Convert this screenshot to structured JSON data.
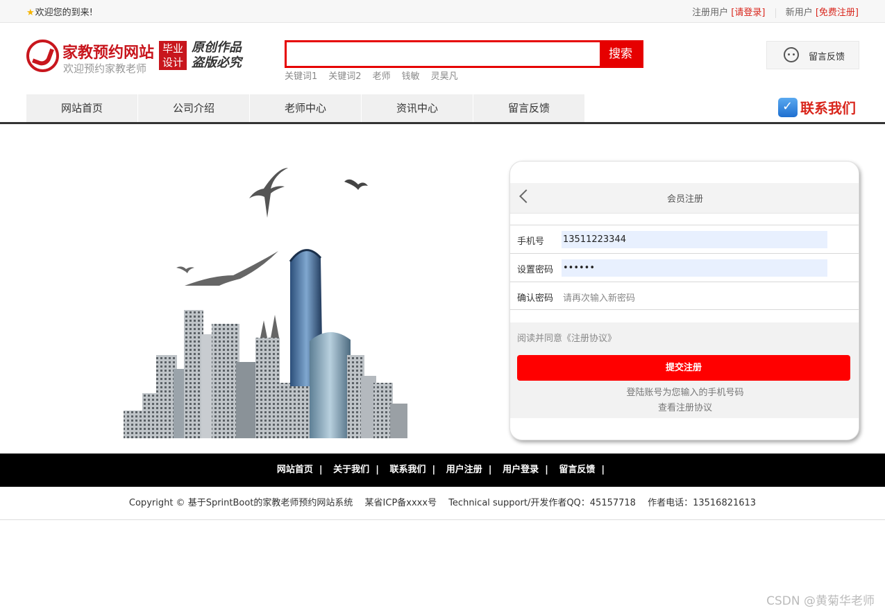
{
  "topbar": {
    "welcome": "欢迎您的到来!",
    "register_prefix": "注册用户",
    "login_link": "[请登录]",
    "new_user_prefix": "新用户",
    "free_register_link": "[免费注册]"
  },
  "header": {
    "site_name": "家教预约网站",
    "site_sub": "欢迎预约家教老师",
    "badge": [
      "毕业",
      "设计"
    ],
    "slogan": [
      "原创作品",
      "盗版必究"
    ],
    "search": {
      "placeholder": "",
      "button": "搜索"
    },
    "keywords": [
      "关键词1",
      "关键词2",
      "老师",
      "钱敏",
      "灵昊凡"
    ],
    "feedback": "留言反馈"
  },
  "nav": {
    "items": [
      "网站首页",
      "公司介绍",
      "老师中心",
      "资讯中心",
      "留言反馈"
    ],
    "contact": "联系我们"
  },
  "register": {
    "title": "会员注册",
    "phone_label": "手机号",
    "phone_value": "13511223344",
    "password_label": "设置密码",
    "password_value": "••••••",
    "confirm_label": "确认密码",
    "confirm_placeholder": "请再次输入新密码",
    "agree": "阅读并同意《注册协议》",
    "submit": "提交注册",
    "hint1": "登陆账号为您输入的手机号码",
    "hint2": "查看注册协议"
  },
  "footer": {
    "links": [
      "网站首页",
      "关于我们",
      "联系我们",
      "用户注册",
      "用户登录",
      "留言反馈"
    ],
    "copyright": "Copyright © 基于SprintBoot的家教老师预约网站系统　 某省ICP备xxxx号　 Technical support/开发作者QQ：45157718　 作者电话：13516821613"
  },
  "watermark": "CSDN @黄菊华老师",
  "colors": {
    "accent": "#e60000",
    "brand": "#c8161d",
    "footer_bg": "#000000"
  }
}
